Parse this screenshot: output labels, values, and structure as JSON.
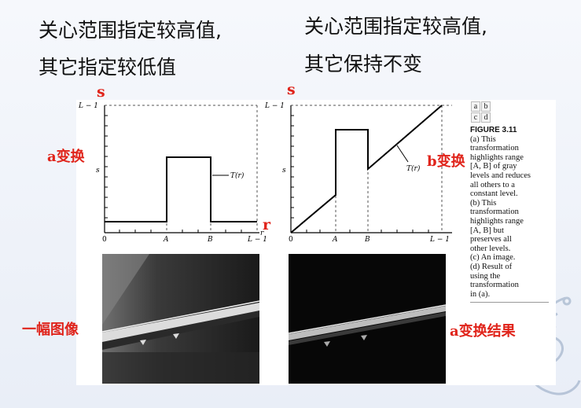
{
  "headings": {
    "left_line1": "关心范围指定较高值,",
    "left_line2": "其它指定较低值",
    "right_line1": "关心范围指定较高值,",
    "right_line2": "其它保持不变"
  },
  "annotations": {
    "s_left": "s",
    "s_right": "s",
    "r_left": "r",
    "a_transform": "a变换",
    "b_transform": "b变换",
    "an_image": "一幅图像",
    "a_result": "a变换结果"
  },
  "plot_labels": {
    "L1": "L − 1",
    "s_axis": "s",
    "r_axis": "r",
    "zero": "0",
    "A": "A",
    "B": "B",
    "T": "T(r)"
  },
  "caption": {
    "grid": [
      "a",
      "b",
      "c",
      "d"
    ],
    "title": "FIGURE 3.11",
    "body": "(a) This\ntransformation\nhighlights range\n[A, B] of gray\nlevels and reduces\nall others to a\nconstant level.\n(b) This\ntransformation\nhighlights range\n[A, B] but\npreserves all\nother levels.\n(c) An image.\n(d) Result of\nusing the\ntransformation\nin (a)."
  },
  "colors": {
    "annotation_red": "#e0241b",
    "heading_black": "#111111"
  }
}
